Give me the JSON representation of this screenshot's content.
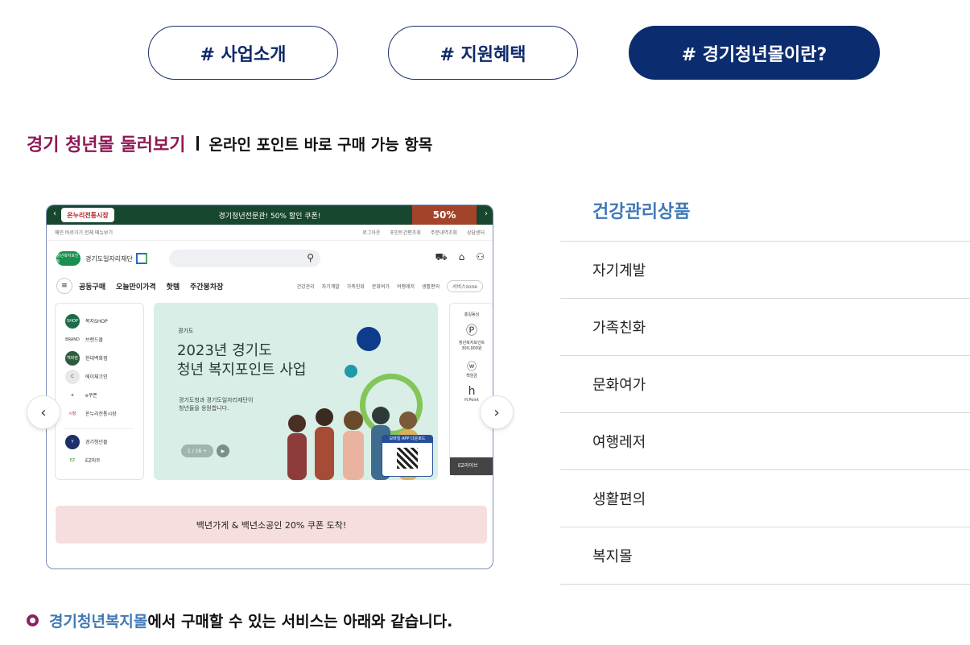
{
  "tabs": [
    {
      "label": "# 사업소개",
      "active": false
    },
    {
      "label": "# 지원혜택",
      "active": false
    },
    {
      "label": "# 경기청년몰이란?",
      "active": true
    }
  ],
  "section": {
    "title": "경기 청년몰 둘러보기",
    "subtitle": "온라인 포인트 바로 구매 가능 항목"
  },
  "mock": {
    "topbar": {
      "logo": "온누리전통시장",
      "text": "경기청년전문관! 50% 할인 쿠폰!",
      "coupon": "50%",
      "prev": "‹",
      "next": "›"
    },
    "util_left": "메인 바로가기   전체 메뉴보기",
    "util_right": [
      "로그아웃",
      "포인트간편조회",
      "주문내역조회",
      "상담센터"
    ],
    "brand": "경기도일자리재단",
    "brand_badge": "청년복지포인트",
    "nav_main": [
      "공동구매",
      "오늘만이가격",
      "핫템",
      "주간붕차장"
    ],
    "nav_small": [
      "건강관리",
      "자기계발",
      "가족친화",
      "문화여가",
      "여행레저",
      "생활편의"
    ],
    "nav_zone": "서비스zone",
    "left_menu": [
      {
        "icon": "SHOP",
        "label": "복지SHOP"
      },
      {
        "icon": "BRAND",
        "label": "브랜드몰"
      },
      {
        "icon": "백화점",
        "label": "현대백화점"
      },
      {
        "icon": "C",
        "label": "에이체크인"
      },
      {
        "icon": "e",
        "label": "e쿠폰"
      },
      {
        "icon": "시장",
        "label": "온누리전통시장"
      },
      {
        "icon": "Y",
        "label": "경기청년몰"
      },
      {
        "icon": "EZ",
        "label": "EZ마트"
      }
    ],
    "hero": {
      "tag": "경기도",
      "line1": "2023년 경기도",
      "line2": "청년 복지포인트 사업",
      "desc1": "경기도청과 경기도일자리재단이",
      "desc2": "청년들을 응원합니다.",
      "pager": "1 / 16  +",
      "play": "▶",
      "qr_label": "모바일 APP 다운로드"
    },
    "right_panel": {
      "greeting": "홍길동님",
      "point_label": "청년복지포인트",
      "point_value": "300,000원",
      "w_label": "책임금",
      "h_label": "H.Point",
      "footer": "EZ라이브"
    },
    "banner": "백년가게 & 백년소공인 20% 쿠폰 도착!"
  },
  "categories": {
    "title": "건강관리상품",
    "items": [
      "자기계발",
      "가족친화",
      "문화여가",
      "여행레저",
      "생활편의",
      "복지몰"
    ]
  },
  "note": {
    "highlight": "경기청년복지몰",
    "rest": "에서 구매할 수 있는 서비스는 아래와 같습니다."
  },
  "arrows": {
    "prev": "‹",
    "next": "›"
  }
}
